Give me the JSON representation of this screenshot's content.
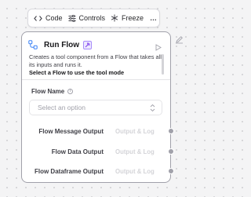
{
  "toolbar": {
    "code_label": "Code",
    "controls_label": "Controls",
    "freeze_label": "Freeze",
    "more_label": "…"
  },
  "node": {
    "title": "Run Flow",
    "description": "Creates a tool component from a Flow that takes all its inputs and runs it.",
    "description_strong": "Select a Flow to use the tool mode",
    "field": {
      "label": "Flow Name",
      "placeholder": "Select an option"
    },
    "outputs": [
      {
        "label": "Flow Message Output",
        "mode": "Output & Log"
      },
      {
        "label": "Flow Data Output",
        "mode": "Output & Log"
      },
      {
        "label": "Flow Dataframe Output",
        "mode": "Output & Log"
      }
    ]
  },
  "colors": {
    "node_border": "#a1a1aa",
    "canvas_bg": "#f4f4f5",
    "flow_icon": "#3b82f6",
    "tool_badge": "#8b5cf6",
    "handle": "#a1a1aa"
  },
  "icons": {
    "code": "code-icon",
    "controls": "sliders-icon",
    "freeze": "snowflake-icon",
    "node": "workflow-icon",
    "tool_badge": "tool-icon",
    "run": "play-icon",
    "select": "chevrons-up-down-icon",
    "edit": "pencil-icon"
  }
}
